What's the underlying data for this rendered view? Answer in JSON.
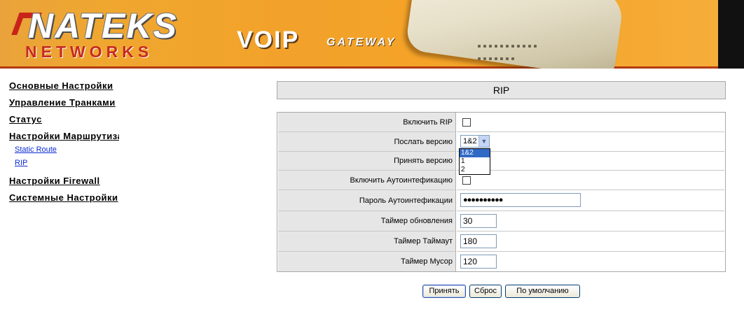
{
  "header": {
    "logo_top": "NATEKS",
    "logo_bottom": "NETWORKS",
    "product_title": "VOIP",
    "product_subtitle": "GATEWAY",
    "brand_color": "#c72b1e",
    "banner_color": "#f2a22a"
  },
  "sidebar": {
    "items": [
      {
        "label": "Основные Настройки",
        "level": "main"
      },
      {
        "label": "Управление Транками",
        "level": "main"
      },
      {
        "label": "Статус",
        "level": "main"
      },
      {
        "label": "Настройки Маршрутизации",
        "level": "main"
      },
      {
        "label": "Static Route",
        "level": "sub"
      },
      {
        "label": "RIP",
        "level": "sub"
      },
      {
        "label": "Настройки Firewall",
        "level": "main"
      },
      {
        "label": "Системные Настройки",
        "level": "main"
      }
    ],
    "link_color": "#0b2bd1"
  },
  "page": {
    "title": "RIP"
  },
  "form": {
    "enable_rip": {
      "label": "Включить RIP",
      "checked": false
    },
    "send_version": {
      "label": "Послать версию",
      "value": "1&2",
      "options": [
        "1&2",
        "1",
        "2"
      ]
    },
    "receive_version": {
      "label": "Принять версию"
    },
    "enable_auth": {
      "label": "Включить Аутоинтефикацию",
      "checked": false
    },
    "auth_password": {
      "label": "Пароль Аутоинтефикации",
      "value": "●●●●●●●●●●"
    },
    "update_timer": {
      "label": "Таймер обновления",
      "value": "30"
    },
    "timeout_timer": {
      "label": "Таймер Таймаут",
      "value": "180"
    },
    "garbage_timer": {
      "label": "Таймер Мусор",
      "value": "120"
    }
  },
  "buttons": {
    "apply": "Принять",
    "reset": "Сброс",
    "default": "По умолчанию"
  }
}
